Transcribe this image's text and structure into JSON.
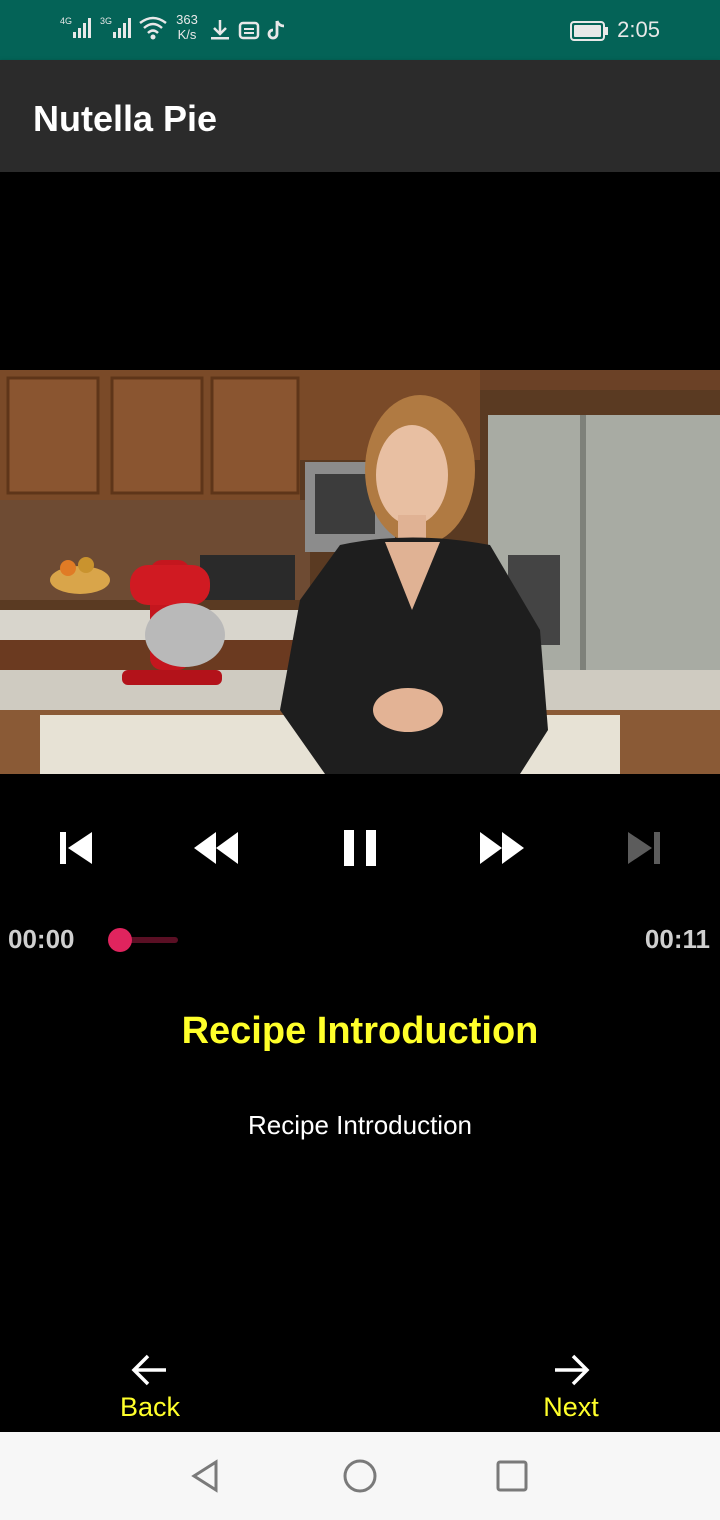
{
  "status_bar": {
    "network_speed_value": "363",
    "network_speed_unit": "K/s",
    "signal_1": "4G",
    "signal_2": "3G",
    "time": "2:05"
  },
  "app_bar": {
    "title": "Nutella Pie"
  },
  "player": {
    "current_time": "00:00",
    "duration": "00:11",
    "progress": 0.0,
    "next_enabled": false
  },
  "step": {
    "title": "Recipe Introduction",
    "description": "Recipe Introduction"
  },
  "navigation": {
    "back_label": "Back",
    "next_label": "Next"
  },
  "colors": {
    "status_bar": "#046357",
    "app_bar": "#2b2b2b",
    "accent_yellow": "#ffff2a",
    "seek_accent": "#e0245e"
  }
}
